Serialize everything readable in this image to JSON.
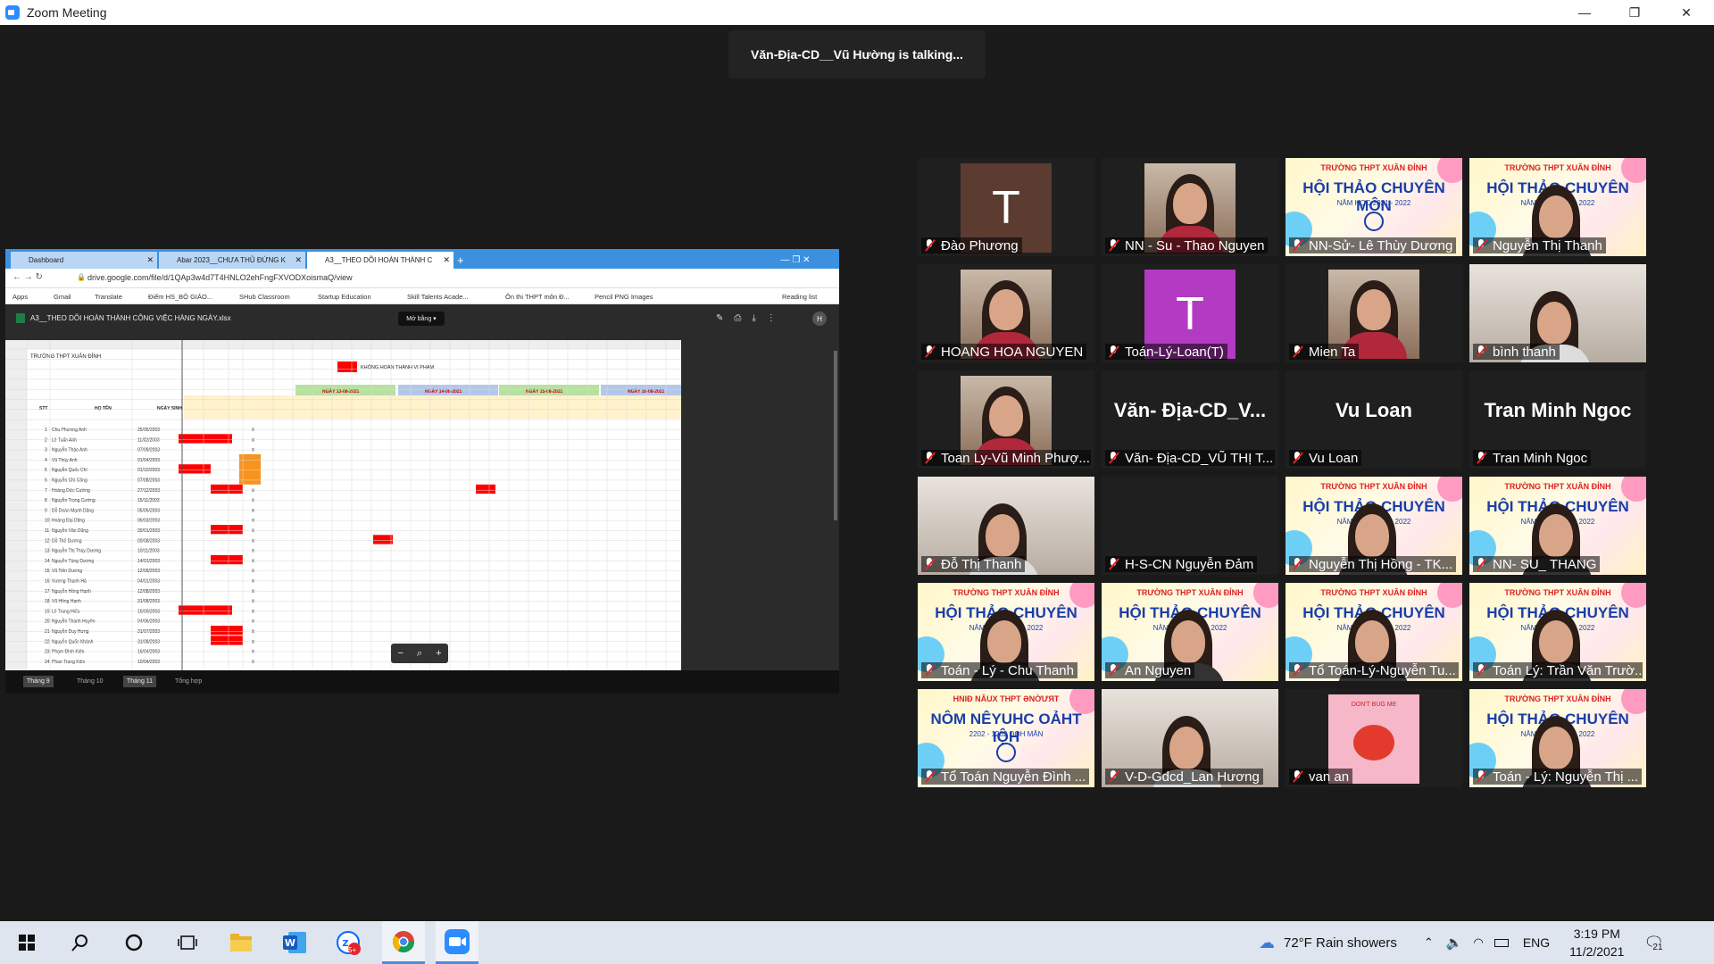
{
  "window": {
    "title": "Zoom Meeting"
  },
  "talking": "Văn-Địa-CD__Vũ Hường is talking...",
  "browser": {
    "tabs": [
      "Dashboard",
      "Abar 2023__CHƯA THỦ ĐỨNG K",
      "A3__THEO DÕI HOÀN THÀNH C"
    ],
    "url": "drive.google.com/file/d/1QAp3w4d7T4HNLO2ehFngFXVODXoismaQ/view",
    "bookmarks": [
      "Apps",
      "Gmail",
      "Translate",
      "Điểm HS_BỘ GIÁO...",
      "SHub Classroom",
      "Startup Education",
      "Skill Talents Acade...",
      "Ôn thi THPT môn Đ...",
      "Pencil PNG Images",
      "Reading list"
    ],
    "file_name": "A3__THEO DÕI HOÀN THÀNH CÔNG VIỆC HÀNG NGÀY.xlsx",
    "open_with": "Mở bằng",
    "sheet_tabs": [
      "Tháng 9",
      "Tháng 10",
      "Tháng 11",
      "Tổng hợp"
    ],
    "sheet": {
      "school": "TRƯỜNG THPT XUÂN ĐỈNH",
      "legend": "KHÔNG HOÀN THÀNH VI PHẠM",
      "day_headers": [
        "NGÀY 13-08-2021",
        "NGÀY 14-08-2021",
        "NGÀY 15-08-2021",
        "NGÀY 16-08-2021"
      ],
      "col_headers": [
        "STT",
        "HỌ TÊN",
        "NGÀY SINH"
      ],
      "rows": [
        [
          "1",
          "Chu Phương Anh",
          "25/05/2003"
        ],
        [
          "2",
          "Lê Tuấn Anh",
          "11/02/2003"
        ],
        [
          "3",
          "Nguyễn Thảo Anh",
          "07/09/2003"
        ],
        [
          "4",
          "Vũ Thùy Anh",
          "01/04/2003"
        ],
        [
          "5",
          "Nguyễn Quốc Chí",
          "01/10/2003"
        ],
        [
          "6",
          "Nguyễn Chí Công",
          "07/08/2003"
        ],
        [
          "7",
          "Hoàng Đức Cường",
          "27/12/2003"
        ],
        [
          "8",
          "Nguyễn Trọng Cường",
          "15/11/2003"
        ],
        [
          "9",
          "Đỗ Đoàn Mạnh Dũng",
          "05/05/2003"
        ],
        [
          "10",
          "Hoàng Đại Dũng",
          "06/03/2003"
        ],
        [
          "11",
          "Nguyễn Văn Dũng",
          "30/01/2003"
        ],
        [
          "12",
          "Đỗ Thế Dương",
          "09/08/2003"
        ],
        [
          "13",
          "Nguyễn Thị Thùy Dương",
          "10/11/2003"
        ],
        [
          "14",
          "Nguyễn Tùng Dương",
          "14/01/2003"
        ],
        [
          "15",
          "Vũ Tiến Dương",
          "12/09/2003"
        ],
        [
          "16",
          "Vương Thanh Hà",
          "04/01/2003"
        ],
        [
          "17",
          "Nguyễn Hồng Hạnh",
          "12/08/2003"
        ],
        [
          "18",
          "Vũ Hồng Hạnh",
          "31/08/2003"
        ],
        [
          "19",
          "Lê Trung Hiếu",
          "16/09/2003"
        ],
        [
          "20",
          "Nguyễn Thanh Huyền",
          "04/06/2003"
        ],
        [
          "21",
          "Nguyễn Duy Hưng",
          "31/07/2003"
        ],
        [
          "22",
          "Nguyễn Quốc Khánh",
          "31/08/2003"
        ],
        [
          "23",
          "Phạm Đình Kiên",
          "16/04/2003"
        ],
        [
          "24",
          "Phan Trung Kiên",
          "10/04/2003"
        ]
      ]
    }
  },
  "participants": [
    {
      "name": "Đào Phương",
      "type": "avatar",
      "letter": "T",
      "color": "#5c3b31"
    },
    {
      "name": "NN - Su - Thao Nguyen",
      "type": "photo"
    },
    {
      "name": "NN-Sử- Lê Thùy Dương",
      "type": "poster"
    },
    {
      "name": "Nguyễn Thị Thanh",
      "type": "poster-face"
    },
    {
      "name": "HOANG HOA NGUYEN",
      "type": "photo"
    },
    {
      "name": "Toán-Lý-Loan(T)",
      "type": "avatar",
      "letter": "T",
      "color": "#b33ac2"
    },
    {
      "name": "Mien Ta",
      "type": "photo"
    },
    {
      "name": "bình thanh",
      "type": "camera"
    },
    {
      "name": "Toan Ly-Vũ Minh Phượ...",
      "type": "photo"
    },
    {
      "name": "Văn- Địa-CD_VŨ THỊ T...",
      "type": "text",
      "big": "Văn- Địa-CD_V..."
    },
    {
      "name": "Vu Loan",
      "type": "text",
      "big": "Vu Loan"
    },
    {
      "name": "Tran Minh Ngoc",
      "type": "text",
      "big": "Tran Minh Ngoc"
    },
    {
      "name": "Đỗ Thị Thanh",
      "type": "camera"
    },
    {
      "name": "H-S-CN Nguyễn Đảm",
      "type": "blank"
    },
    {
      "name": "Nguyễn Thị Hồng - TK...",
      "type": "poster-face"
    },
    {
      "name": "NN- SU_ THANG",
      "type": "poster-face"
    },
    {
      "name": "Toán - Lý - Chu Thanh",
      "type": "poster-face"
    },
    {
      "name": "An Nguyen",
      "type": "poster-face"
    },
    {
      "name": "Tổ Toán-Lý-Nguyễn Tu...",
      "type": "poster-face"
    },
    {
      "name": "Toán Lý: Trần Văn Trườ...",
      "type": "poster-face"
    },
    {
      "name": "Tổ Toán Nguyễn Đình ...",
      "type": "poster-mirror"
    },
    {
      "name": "V-D-Gdcd_Lan Hương",
      "type": "camera"
    },
    {
      "name": "van an",
      "type": "sticker"
    },
    {
      "name": "Toán - Lý: Nguyễn Thị ...",
      "type": "poster-face"
    }
  ],
  "poster": {
    "line1": "TRƯỜNG THPT XUÂN ĐỈNH",
    "line2": "HỘI THẢO CHUYÊN MÔN",
    "line3": "NĂM HỌC 2021 - 2022",
    "mirror1": "HNIĐ NÂUX THPT ƏNỜƯЯT",
    "mirror2": "NÔM NÊYUHC OẢHT IỘH",
    "mirror3": "2202 - 1202 ƆỌH MĂN"
  },
  "sticker_text": "DON'T BUG ME",
  "taskbar": {
    "weather": "72°F  Rain showers",
    "lang": "ENG",
    "time": "3:19 PM",
    "date": "11/2/2021",
    "notif_count": "21",
    "zalo_badge": "5+"
  }
}
